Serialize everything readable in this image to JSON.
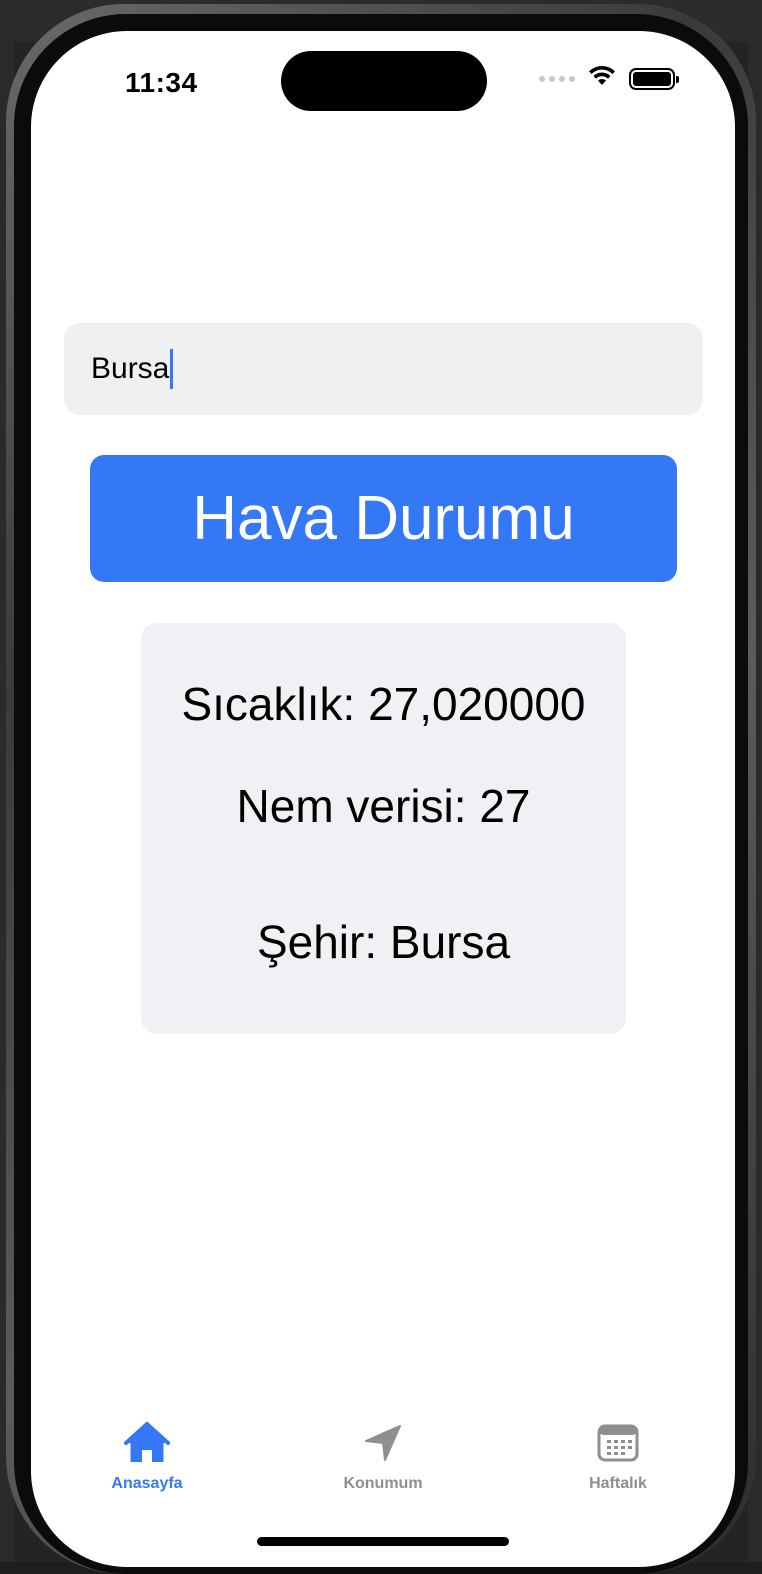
{
  "status_bar": {
    "time": "11:34",
    "wifi_icon": "wifi-icon",
    "battery_icon": "battery-icon",
    "signal_icon": "cellular-signal-icon"
  },
  "search": {
    "value": "Bursa"
  },
  "primary_button": {
    "label": "Hava Durumu"
  },
  "info_card": {
    "temperature": "Sıcaklık: 27,020000",
    "humidity": "Nem verisi: 27",
    "city": "Şehir: Bursa"
  },
  "tab_bar": {
    "items": [
      {
        "label": "Anasayfa",
        "icon": "house-icon",
        "active": true
      },
      {
        "label": "Konumum",
        "icon": "location-arrow-icon",
        "active": false
      },
      {
        "label": "Haftalık",
        "icon": "calendar-icon",
        "active": false
      }
    ]
  },
  "colors": {
    "accent": "#3478f6",
    "field_bg": "#f0f0f3",
    "card_bg": "#f1f1f5",
    "inactive_tab": "#8e8e93"
  }
}
